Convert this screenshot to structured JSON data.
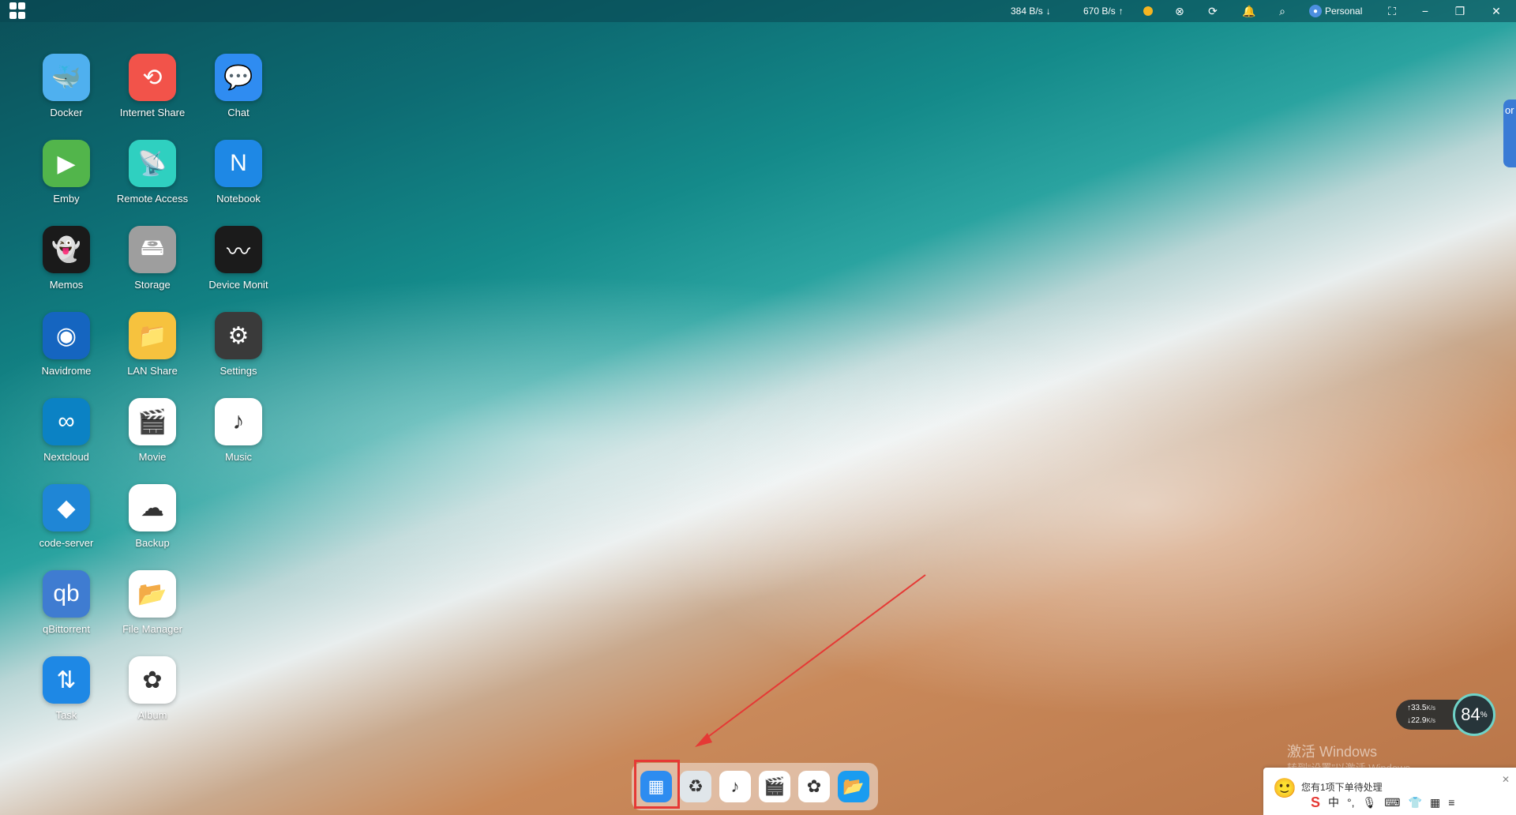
{
  "topbar": {
    "download_speed": "384 B/s",
    "upload_speed": "670 B/s",
    "user": "Personal",
    "status_color": "#f5b521"
  },
  "apps": [
    {
      "label": "Docker",
      "icon": "docker-whale-icon",
      "color": "#4fb0ef"
    },
    {
      "label": "Internet Share",
      "icon": "share-link-icon",
      "color": "#f2534a"
    },
    {
      "label": "Chat",
      "icon": "chat-bubble-icon",
      "color": "#2f8cf1"
    },
    {
      "label": "Emby",
      "icon": "emby-play-icon",
      "color": "#52b54b"
    },
    {
      "label": "Remote Access",
      "icon": "remote-antenna-icon",
      "color": "#2fd0c0"
    },
    {
      "label": "Notebook",
      "icon": "notebook-icon",
      "color": "#1e88e5"
    },
    {
      "label": "Memos",
      "icon": "memos-ghost-icon",
      "color": "#1a1a1a"
    },
    {
      "label": "Storage",
      "icon": "hard-drive-icon",
      "color": "#9e9e9e"
    },
    {
      "label": "Device Monit",
      "icon": "device-monitor-icon",
      "color": "#1b1b1b"
    },
    {
      "label": "Navidrome",
      "icon": "vinyl-icon",
      "color": "#1565c0"
    },
    {
      "label": "LAN Share",
      "icon": "folder-network-icon",
      "color": "#f6c23e"
    },
    {
      "label": "Settings",
      "icon": "gear-icon",
      "color": "#3a3a3a"
    },
    {
      "label": "Nextcloud",
      "icon": "nextcloud-icon",
      "color": "#0b82c4"
    },
    {
      "label": "Movie",
      "icon": "clapperboard-icon",
      "color": "#ffffff"
    },
    {
      "label": "Music",
      "icon": "music-note-icon",
      "color": "#ffffff"
    },
    {
      "label": "code-server",
      "icon": "vscode-icon",
      "color": "#1f86d6"
    },
    {
      "label": "Backup",
      "icon": "cloud-backup-icon",
      "color": "#ffffff"
    },
    {
      "label": "qBittorrent",
      "icon": "qbittorrent-icon",
      "color": "#3f7cd1"
    },
    {
      "label": "File Manager",
      "icon": "folder-icon",
      "color": "#ffffff"
    },
    {
      "label": "Task",
      "icon": "task-arrows-icon",
      "color": "#1e88e5"
    },
    {
      "label": "Album",
      "icon": "photos-flower-icon",
      "color": "#ffffff"
    }
  ],
  "dock": [
    {
      "name": "launcher",
      "icon": "app-grid-icon"
    },
    {
      "name": "recycle",
      "icon": "recycle-bin-icon"
    },
    {
      "name": "music",
      "icon": "music-note-icon"
    },
    {
      "name": "movie",
      "icon": "clapperboard-icon"
    },
    {
      "name": "album",
      "icon": "photos-flower-icon"
    },
    {
      "name": "files",
      "icon": "folder-icon"
    }
  ],
  "speed_widget": {
    "up": "33.5",
    "up_unit": "K/s",
    "down": "22.9",
    "down_unit": "K/s",
    "percent": "84",
    "percent_unit": "%"
  },
  "watermark": {
    "line1": "激活 Windows",
    "line2": "转到“设置”以激活 Windows。"
  },
  "ime": {
    "hint": "您有1项下单待处理",
    "lang": "中"
  },
  "side_tab": "or"
}
